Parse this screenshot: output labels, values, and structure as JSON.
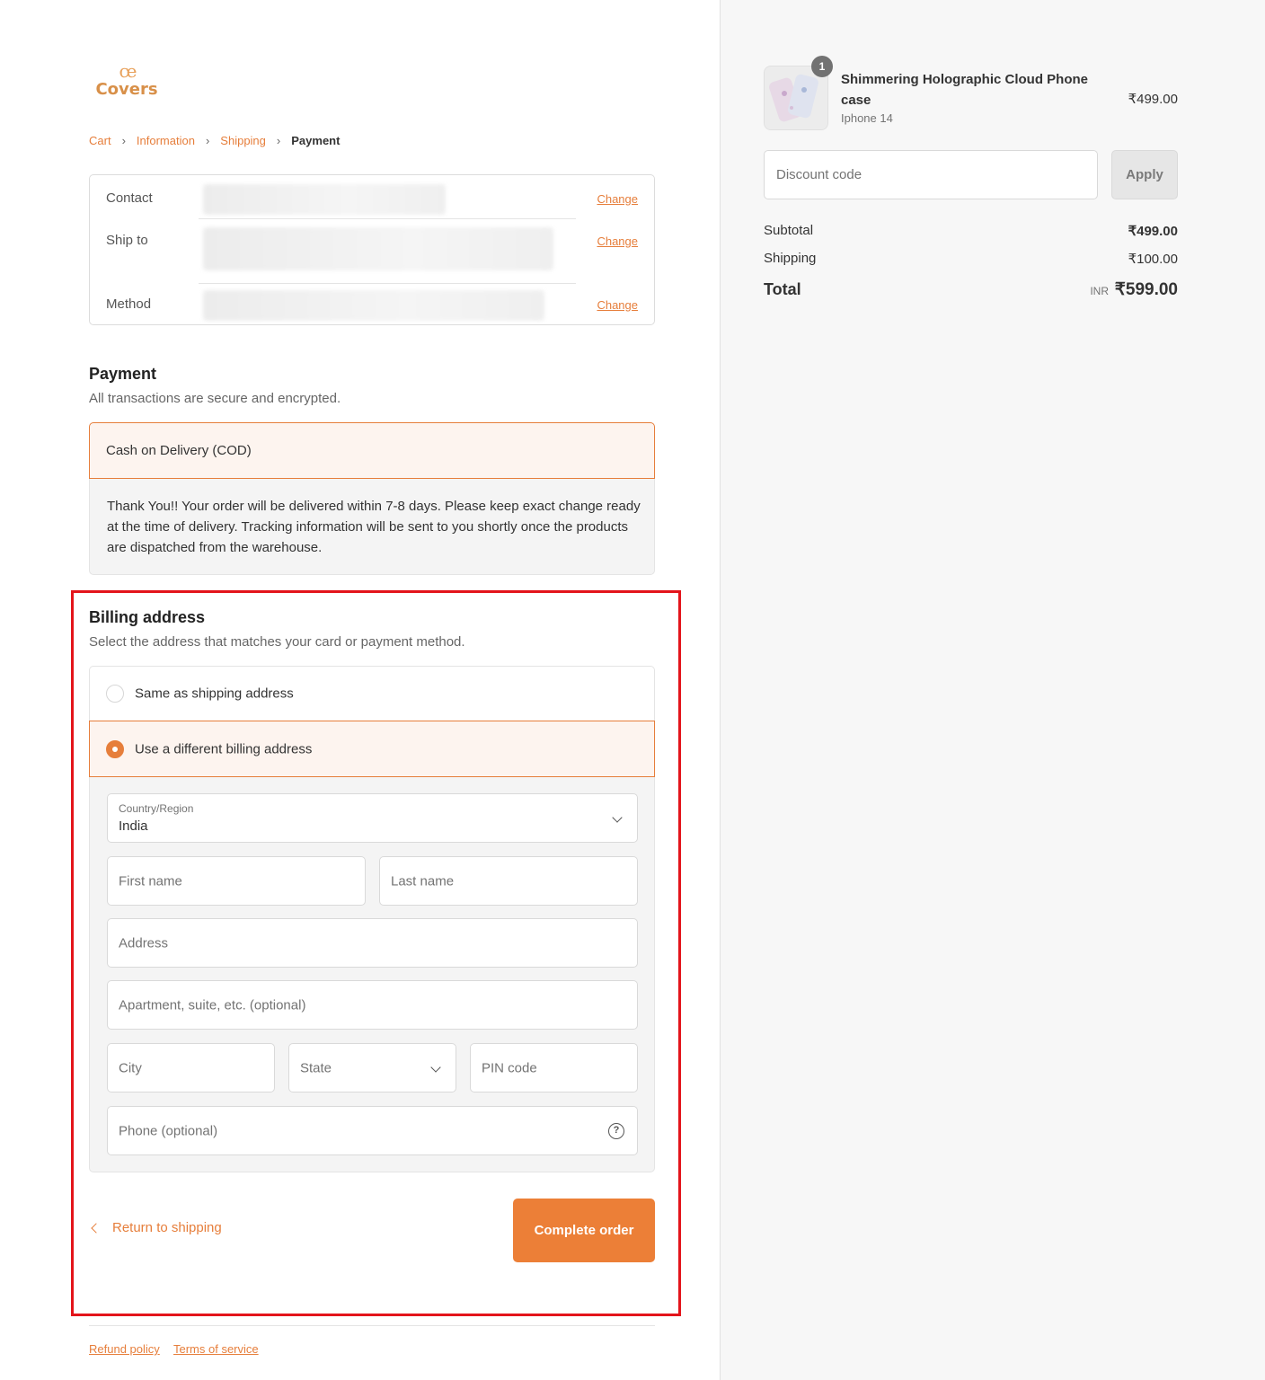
{
  "brand": {
    "logo_mark": "ce",
    "name": "Covers"
  },
  "breadcrumb": {
    "cart": "Cart",
    "information": "Information",
    "shipping": "Shipping",
    "payment": "Payment"
  },
  "summary": {
    "contact_label": "Contact",
    "ship_to_label": "Ship to",
    "method_label": "Method",
    "change": "Change"
  },
  "payment": {
    "title": "Payment",
    "subtitle": "All transactions are secure and encrypted.",
    "method": "Cash on Delivery (COD)",
    "note": "Thank You!! Your order will be delivered within 7-8 days. Please keep exact change ready at the time of delivery. Tracking information will be sent to you shortly once the products are dispatched from the warehouse."
  },
  "billing": {
    "title": "Billing address",
    "subtitle": "Select the address that matches your card or payment method.",
    "option_same": "Same as shipping address",
    "option_different": "Use a different billing address",
    "selected": "different"
  },
  "form": {
    "country_label": "Country/Region",
    "country_value": "India",
    "first_name": "First name",
    "last_name": "Last name",
    "address": "Address",
    "apartment": "Apartment, suite, etc. (optional)",
    "city": "City",
    "state": "State",
    "pin": "PIN code",
    "phone": "Phone (optional)",
    "help_glyph": "?"
  },
  "actions": {
    "return": "Return to shipping",
    "complete": "Complete order"
  },
  "footer": {
    "refund": "Refund policy",
    "terms": "Terms of service"
  },
  "order": {
    "quantity": "1",
    "product_name": "Shimmering Holographic Cloud Phone case",
    "variant": "Iphone 14",
    "price": "₹499.00",
    "discount_placeholder": "Discount code",
    "apply": "Apply",
    "subtotal_label": "Subtotal",
    "subtotal": "₹499.00",
    "shipping_label": "Shipping",
    "shipping": "₹100.00",
    "total_label": "Total",
    "currency": "INR",
    "total": "₹599.00"
  },
  "colors": {
    "accent": "#e67e3b",
    "highlight": "#e3141b",
    "panel": "#f7f7f7"
  }
}
